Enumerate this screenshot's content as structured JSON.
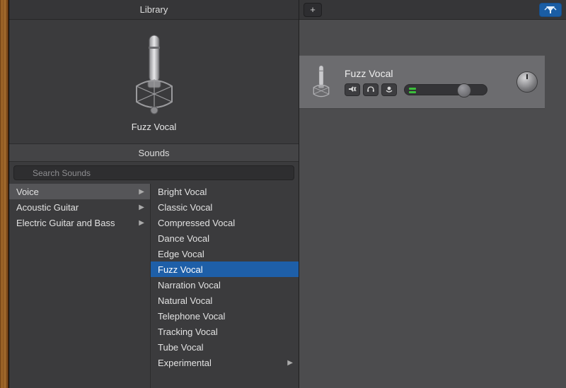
{
  "library": {
    "header": "Library",
    "preset_name": "Fuzz Vocal",
    "sounds_header": "Sounds",
    "search_placeholder": "Search Sounds",
    "categories": [
      {
        "label": "Voice",
        "selected": true,
        "has_children": true
      },
      {
        "label": "Acoustic Guitar",
        "selected": false,
        "has_children": true
      },
      {
        "label": "Electric Guitar and Bass",
        "selected": false,
        "has_children": true
      }
    ],
    "presets": [
      {
        "label": "Bright Vocal",
        "selected": false,
        "has_children": false
      },
      {
        "label": "Classic Vocal",
        "selected": false,
        "has_children": false
      },
      {
        "label": "Compressed Vocal",
        "selected": false,
        "has_children": false
      },
      {
        "label": "Dance Vocal",
        "selected": false,
        "has_children": false
      },
      {
        "label": "Edge Vocal",
        "selected": false,
        "has_children": false
      },
      {
        "label": "Fuzz Vocal",
        "selected": true,
        "has_children": false
      },
      {
        "label": "Narration Vocal",
        "selected": false,
        "has_children": false
      },
      {
        "label": "Natural Vocal",
        "selected": false,
        "has_children": false
      },
      {
        "label": "Telephone Vocal",
        "selected": false,
        "has_children": false
      },
      {
        "label": "Tracking Vocal",
        "selected": false,
        "has_children": false
      },
      {
        "label": "Tube Vocal",
        "selected": false,
        "has_children": false
      },
      {
        "label": "Experimental",
        "selected": false,
        "has_children": true
      }
    ]
  },
  "tracks": {
    "add_label": "+",
    "track_name": "Fuzz Vocal"
  }
}
